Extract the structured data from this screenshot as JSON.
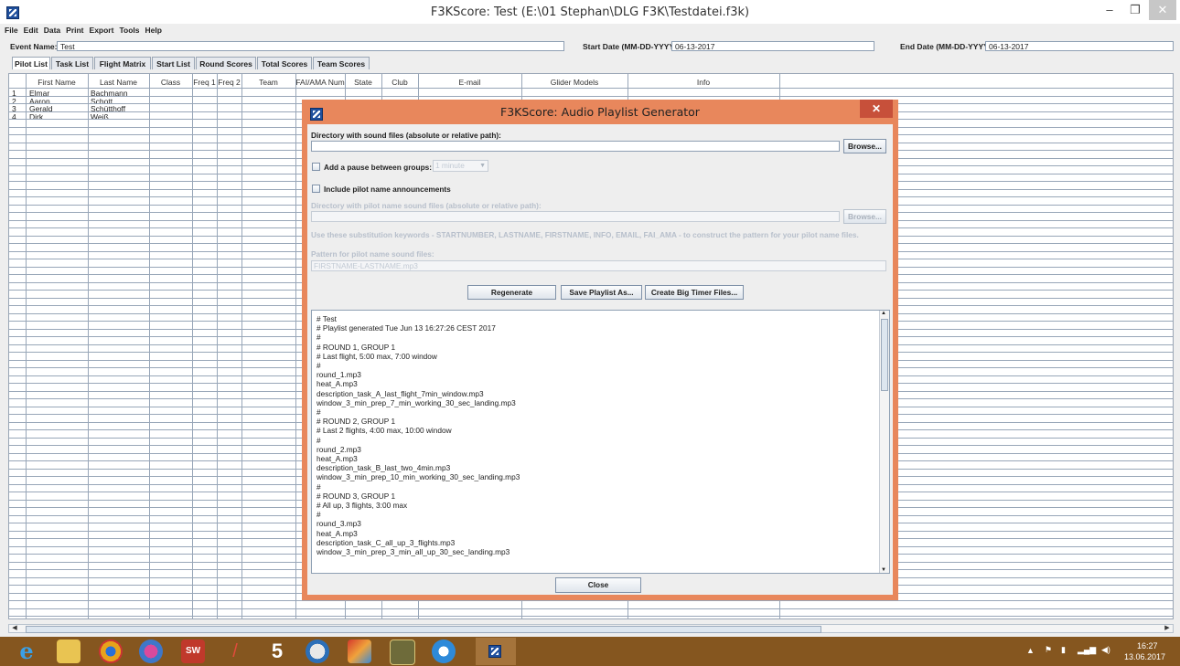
{
  "window": {
    "title": "F3KScore: Test (E:\\01 Stephan\\DLG F3K\\Testdatei.f3k)",
    "minimize": "‒",
    "maximize": "❐",
    "close": "✕"
  },
  "menu": [
    "File",
    "Edit",
    "Data",
    "Print",
    "Export",
    "Tools",
    "Help"
  ],
  "event": {
    "name_label": "Event Name:",
    "name_value": "Test",
    "start_label": "Start Date (MM-DD-YYYY):",
    "start_value": "06-13-2017",
    "end_label": "End Date (MM-DD-YYYY):",
    "end_value": "06-13-2017"
  },
  "tabs": [
    "Pilot List",
    "Task List",
    "Flight Matrix",
    "Start List",
    "Round Scores",
    "Total Scores",
    "Team Scores"
  ],
  "table": {
    "columns": [
      "First Name",
      "Last Name",
      "Class",
      "Freq 1",
      "Freq 2",
      "Team",
      "FAI/AMA Num",
      "State",
      "Club",
      "E-mail",
      "Glider Models",
      "Info"
    ],
    "rows": [
      {
        "num": "1",
        "first": "Elmar",
        "last": "Bachmann"
      },
      {
        "num": "2",
        "first": "Aaron",
        "last": "Schott"
      },
      {
        "num": "3",
        "first": "Gerald",
        "last": "Schütthoff"
      },
      {
        "num": "4",
        "first": "Dirk",
        "last": "Weiß"
      }
    ]
  },
  "dialog": {
    "title": "F3KScore: Audio Playlist Generator",
    "close": "✕",
    "dir_label": "Directory with sound files (absolute or relative path):",
    "dir_value": "",
    "browse": "Browse...",
    "pause_label": "Add a pause between groups:",
    "pause_value": "1 minute",
    "pilot_label": "Include pilot name announcements",
    "pilot_dir_label": "Directory with pilot name sound files (absolute or relative path):",
    "pilot_dir_value": "",
    "browse2": "Browse...",
    "hint": "Use these substitution keywords - STARTNUMBER, LASTNAME, FIRSTNAME, INFO, EMAIL, FAI_AMA - to construct the pattern for your pilot name files.",
    "pattern_label": "Pattern for pilot name sound files:",
    "pattern_value": "FIRSTNAME-LASTNAME.mp3",
    "btn_regenerate": "Regenerate",
    "btn_save": "Save Playlist As...",
    "btn_timer": "Create Big Timer Files...",
    "playlist": [
      "# Test",
      "# Playlist generated Tue Jun 13 16:27:26 CEST 2017",
      "#",
      "# ROUND 1, GROUP 1",
      "# Last flight, 5:00 max, 7:00 window",
      "#",
      "round_1.mp3",
      "heat_A.mp3",
      "description_task_A_last_flight_7min_window.mp3",
      "window_3_min_prep_7_min_working_30_sec_landing.mp3",
      "#",
      "# ROUND 2, GROUP 1",
      "# Last 2 flights, 4:00 max, 10:00 window",
      "#",
      "round_2.mp3",
      "heat_A.mp3",
      "description_task_B_last_two_4min.mp3",
      "window_3_min_prep_10_min_working_30_sec_landing.mp3",
      "#",
      "# ROUND 3, GROUP 1",
      "# All up, 3 flights, 3:00 max",
      "#",
      "round_3.mp3",
      "heat_A.mp3",
      "description_task_C_all_up_3_flights.mp3",
      "window_3_min_prep_3_min_all_up_30_sec_landing.mp3"
    ],
    "btn_close": "Close"
  },
  "taskbar": {
    "time": "16:27",
    "date": "13.06.2017"
  }
}
